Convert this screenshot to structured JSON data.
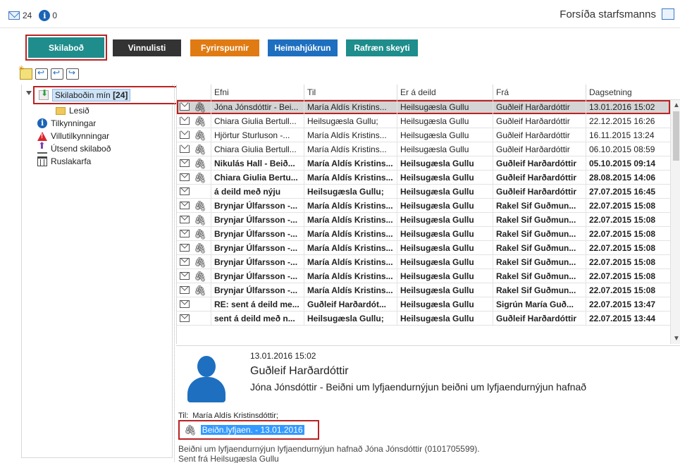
{
  "topbar": {
    "mail_count": "24",
    "info_count": "0",
    "home_link": "Forsíða starfsmanns"
  },
  "tabs": [
    {
      "label": "Skilaboð",
      "color": "#1e8d8c"
    },
    {
      "label": "Vinnulisti",
      "color": "#333333"
    },
    {
      "label": "Fyrirspurnir",
      "color": "#e07b13"
    },
    {
      "label": "Heimahjúkrun",
      "color": "#1e6fc0"
    },
    {
      "label": "Rafræn skeyti",
      "color": "#1e8d8c"
    }
  ],
  "toolbar": {
    "icons": [
      "new-message-icon",
      "reply-icon",
      "reply-all-icon",
      "forward-icon"
    ]
  },
  "folders": [
    {
      "label": "Skilaboðin mín",
      "count": "[24]",
      "icon": "inbox-icon"
    },
    {
      "label": "Lesið",
      "icon": "folder-icon"
    },
    {
      "label": "Tilkynningar",
      "icon": "info-icon"
    },
    {
      "label": "Villutilkynningar",
      "icon": "warning-icon"
    },
    {
      "label": "Útsend skilaboð",
      "icon": "sent-icon"
    },
    {
      "label": "Ruslakarfa",
      "icon": "trash-icon"
    }
  ],
  "grid": {
    "columns": [
      "Efni",
      "Til",
      "Er á deild",
      "Frá",
      "Dagsetning"
    ],
    "rows": [
      {
        "subject": "Jóna Jónsdóttir - Bei...",
        "to": "María Aldís Kristins...",
        "dept": "Heilsugæsla Gullu",
        "from": "Guðleif Harðardóttir",
        "date": "13.01.2016 15:02",
        "unread": false,
        "attach": true,
        "selected": true
      },
      {
        "subject": "Chiara Giulia Bertull...",
        "to": "Heilsugæsla Gullu;",
        "dept": "Heilsugæsla Gullu",
        "from": "Guðleif Harðardóttir",
        "date": "22.12.2015 16:26",
        "unread": false,
        "attach": true,
        "selected": false
      },
      {
        "subject": "Hjörtur Sturluson -...",
        "to": "María Aldís Kristins...",
        "dept": "Heilsugæsla Gullu",
        "from": "Guðleif Harðardóttir",
        "date": "16.11.2015 13:24",
        "unread": false,
        "attach": true,
        "selected": false
      },
      {
        "subject": "Chiara Giulia Bertull...",
        "to": "María Aldís Kristins...",
        "dept": "Heilsugæsla Gullu",
        "from": "Guðleif Harðardóttir",
        "date": "06.10.2015 08:59",
        "unread": false,
        "attach": true,
        "selected": false
      },
      {
        "subject": "Nikulás Hall - Beið...",
        "to": "María Aldís Kristins...",
        "dept": "Heilsugæsla Gullu",
        "from": "Guðleif Harðardóttir",
        "date": "05.10.2015 09:14",
        "unread": true,
        "attach": true,
        "selected": false
      },
      {
        "subject": "Chiara Giulia Bertu...",
        "to": "María Aldís Kristins...",
        "dept": "Heilsugæsla Gullu",
        "from": "Guðleif Harðardóttir",
        "date": "28.08.2015 14:06",
        "unread": true,
        "attach": true,
        "selected": false
      },
      {
        "subject": "á deild með nýju",
        "to": "Heilsugæsla Gullu;",
        "dept": "Heilsugæsla Gullu",
        "from": "Guðleif Harðardóttir",
        "date": "27.07.2015 16:45",
        "unread": true,
        "attach": false,
        "selected": false
      },
      {
        "subject": "Brynjar Úlfarsson -...",
        "to": "María Aldís Kristins...",
        "dept": "Heilsugæsla Gullu",
        "from": "Rakel Sif Guðmun...",
        "date": "22.07.2015 15:08",
        "unread": true,
        "attach": true,
        "selected": false
      },
      {
        "subject": "Brynjar Úlfarsson -...",
        "to": "María Aldís Kristins...",
        "dept": "Heilsugæsla Gullu",
        "from": "Rakel Sif Guðmun...",
        "date": "22.07.2015 15:08",
        "unread": true,
        "attach": true,
        "selected": false
      },
      {
        "subject": "Brynjar Úlfarsson -...",
        "to": "María Aldís Kristins...",
        "dept": "Heilsugæsla Gullu",
        "from": "Rakel Sif Guðmun...",
        "date": "22.07.2015 15:08",
        "unread": true,
        "attach": true,
        "selected": false
      },
      {
        "subject": "Brynjar Úlfarsson -...",
        "to": "María Aldís Kristins...",
        "dept": "Heilsugæsla Gullu",
        "from": "Rakel Sif Guðmun...",
        "date": "22.07.2015 15:08",
        "unread": true,
        "attach": true,
        "selected": false
      },
      {
        "subject": "Brynjar Úlfarsson -...",
        "to": "María Aldís Kristins...",
        "dept": "Heilsugæsla Gullu",
        "from": "Rakel Sif Guðmun...",
        "date": "22.07.2015 15:08",
        "unread": true,
        "attach": true,
        "selected": false
      },
      {
        "subject": "Brynjar Úlfarsson -...",
        "to": "María Aldís Kristins...",
        "dept": "Heilsugæsla Gullu",
        "from": "Rakel Sif Guðmun...",
        "date": "22.07.2015 15:08",
        "unread": true,
        "attach": true,
        "selected": false
      },
      {
        "subject": "Brynjar Úlfarsson -...",
        "to": "María Aldís Kristins...",
        "dept": "Heilsugæsla Gullu",
        "from": "Rakel Sif Guðmun...",
        "date": "22.07.2015 15:08",
        "unread": true,
        "attach": true,
        "selected": false
      },
      {
        "subject": "RE: sent á deild me...",
        "to": "Guðleif Harðardót...",
        "dept": "Heilsugæsla Gullu",
        "from": "Sigrún María Guð...",
        "date": "22.07.2015 13:47",
        "unread": true,
        "attach": false,
        "selected": false
      },
      {
        "subject": "sent á deild með n...",
        "to": "Heilsugæsla Gullu;",
        "dept": "Heilsugæsla Gullu",
        "from": "Guðleif Harðardóttir",
        "date": "22.07.2015 13:44",
        "unread": true,
        "attach": false,
        "selected": false
      }
    ]
  },
  "preview": {
    "date": "13.01.2016 15:02",
    "from": "Guðleif Harðardóttir",
    "subject": "Jóna Jónsdóttir - Beiðni um lyfjaendurnýjun beiðni um lyfjaendurnýjun hafnað",
    "to_label": "Til:",
    "to_value": "María Aldís Kristinsdóttir;",
    "attachment": "Beiðn.lyfjaen. - 13.01.2016",
    "body_line1": "Beiðni um lyfjaendurnýjun lyfjaendurnýjun hafnað Jóna Jónsdóttir (0101705599).",
    "body_line2": "Sent frá Heilsugæsla Gullu"
  },
  "colors": {
    "accent_red": "#bb2222",
    "selected_row": "#d4d4d4",
    "link_highlight": "#3399ff"
  }
}
